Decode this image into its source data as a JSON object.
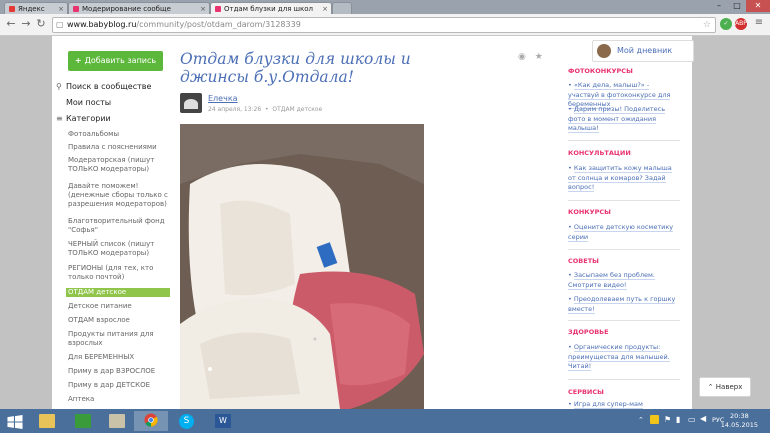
{
  "browser": {
    "tabs": [
      {
        "title": "Яндекс",
        "favicon_color": "#e53935"
      },
      {
        "title": "Модерирование сообще",
        "favicon_color": "#e8336f"
      },
      {
        "title": "Отдам блузки для школ",
        "favicon_color": "#e8336f"
      }
    ],
    "url_host": "www.babyblog.ru",
    "url_path": "/community/post/otdam_darom/3128339"
  },
  "left_nav": {
    "add_button": "Добавить запись",
    "search": "Поиск в сообществе",
    "my_posts": "Мои посты",
    "categories": "Категории",
    "items": [
      "Фотоальбомы",
      "Правила с пояснениями",
      "Модераторская (пишут ТОЛЬКО модераторы)",
      "Давайте поможем! (денежные сборы только с разрешения модераторов)",
      "Благотворительный фонд \"Софья\"",
      "ЧЕРНЫЙ список (пишут ТОЛЬКО модераторы)",
      "РЕГИОНЫ (для тех, кто только почтой)",
      "ОТДАМ детское",
      "Детское питание",
      "ОТДАМ взрослое",
      "Продукты питания для взрослых",
      "Для БЕРЕМЕННЫХ",
      "Приму в дар ВЗРОСЛОЕ",
      "Приму в дар ДЕТСКОЕ",
      "Аптека"
    ]
  },
  "post": {
    "title": "Отдам блузки для школы и джинсы б.у.Отдала!",
    "author": "Елечка",
    "date": "24 апреля, 13:26",
    "category": "ОТДАМ детское"
  },
  "right_sidebar": {
    "diary": "Мой дневник",
    "sections": [
      {
        "heading": "ФОТОКОНКУРСЫ",
        "items": [
          "«Как дела, малыш?» - участвуй в фотоконкурсе для беременных",
          "Дарим призы! Поделитесь фото в момент ожидания малыша!"
        ]
      },
      {
        "heading": "КОНСУЛЬТАЦИИ",
        "items": [
          "Как защитить кожу малыша от солнца и комаров? Задай вопрос!"
        ]
      },
      {
        "heading": "КОНКУРСЫ",
        "items": [
          "Оцените детскую косметику серии"
        ]
      },
      {
        "heading": "СОВЕТЫ",
        "items": [
          "Засыпаем без проблем. Смотрите видео!",
          "Преодолеваем путь к горшку вместе!"
        ]
      },
      {
        "heading": "ЗДОРОВЬЕ",
        "items": [
          "Органические продукты: преимущества для малышей. Читай!"
        ]
      },
      {
        "heading": "СЕРВИСЫ",
        "items": [
          "Игра для супер-мам"
        ]
      }
    ],
    "back_to_top": "Наверх"
  },
  "taskbar": {
    "language": "РУС",
    "time": "20:38",
    "date": "14.05.2015"
  },
  "colors": {
    "accent_green": "#5cb83a",
    "link_blue": "#4c6fb6",
    "heading_pink": "#e8336f",
    "selected_green": "#8fc54a"
  }
}
